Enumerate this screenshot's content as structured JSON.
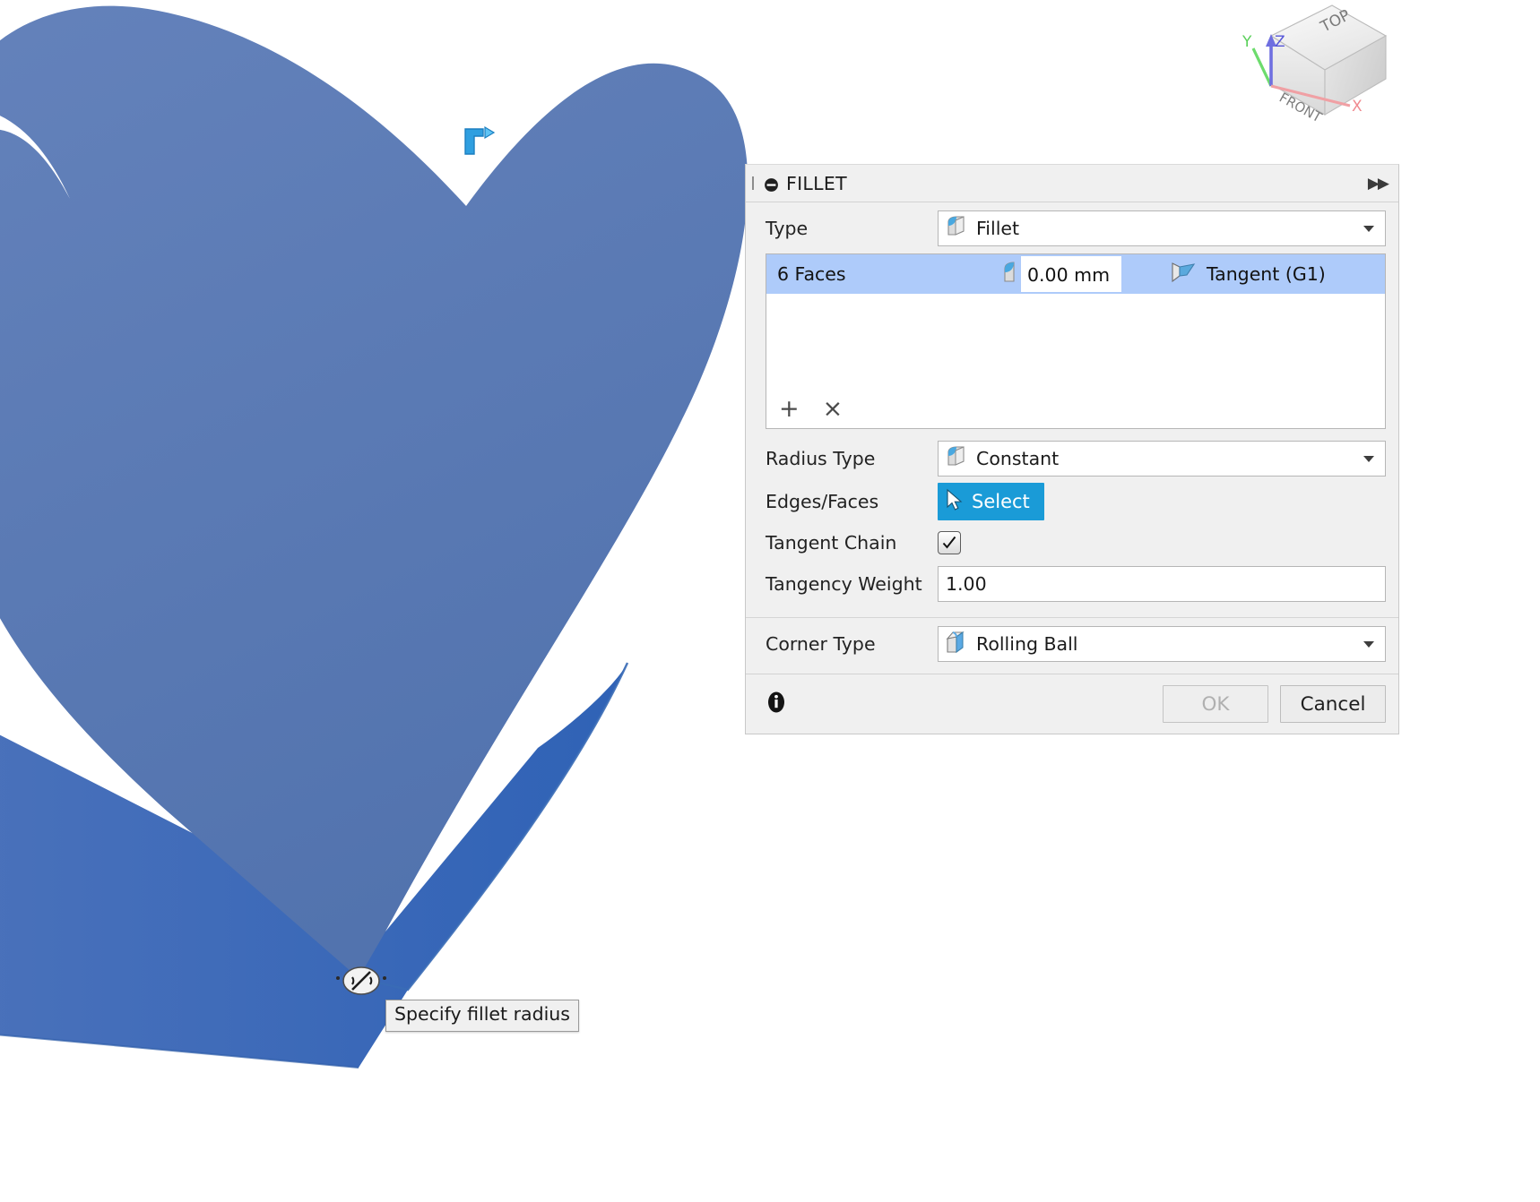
{
  "viewport": {
    "background_color": "#ffffff",
    "solid_color": "#5b7bb5",
    "solid_shade_color": "#3f6cb8",
    "solid_name": "heart-shaped-solid",
    "cursor_glyph": "fillet-cursor",
    "dimension_marker": "radius-dimension-marker",
    "tooltip": "Specify fillet radius"
  },
  "navcube": {
    "top_face_label": "TOP",
    "front_face_label": "FRONT",
    "axis_x": "X",
    "axis_y": "Y",
    "axis_z": "Z",
    "x_color": "#e8888c",
    "y_color": "#6ddc6d",
    "z_color": "#6f6fe0"
  },
  "dialog": {
    "title": "FILLET",
    "collapse_icon": "expand-right-icon",
    "minimize_icon": "minus-circle-icon",
    "type": {
      "label": "Type",
      "value": "Fillet",
      "icon": "fillet-icon"
    },
    "selection_list": {
      "rows": [
        {
          "name": "6 Faces",
          "radius": "0.00 mm",
          "radius_icon": "fillet-icon",
          "continuity": "Tangent (G1)",
          "continuity_icon": "tangent-g1-icon",
          "selected": true
        }
      ],
      "add_label": "+",
      "remove_label": "×"
    },
    "radius_type": {
      "label": "Radius Type",
      "value": "Constant",
      "icon": "fillet-icon"
    },
    "edges_faces": {
      "label": "Edges/Faces",
      "button_label": "Select",
      "button_icon": "cursor-arrow-icon",
      "button_color": "#1a9bd7"
    },
    "tangent_chain": {
      "label": "Tangent Chain",
      "checked": true
    },
    "tangency_weight": {
      "label": "Tangency Weight",
      "value": "1.00"
    },
    "corner_type": {
      "label": "Corner Type",
      "value": "Rolling Ball",
      "icon": "rolling-ball-icon"
    },
    "footer": {
      "info_icon": "info-icon",
      "ok_label": "OK",
      "ok_enabled": false,
      "cancel_label": "Cancel"
    }
  }
}
